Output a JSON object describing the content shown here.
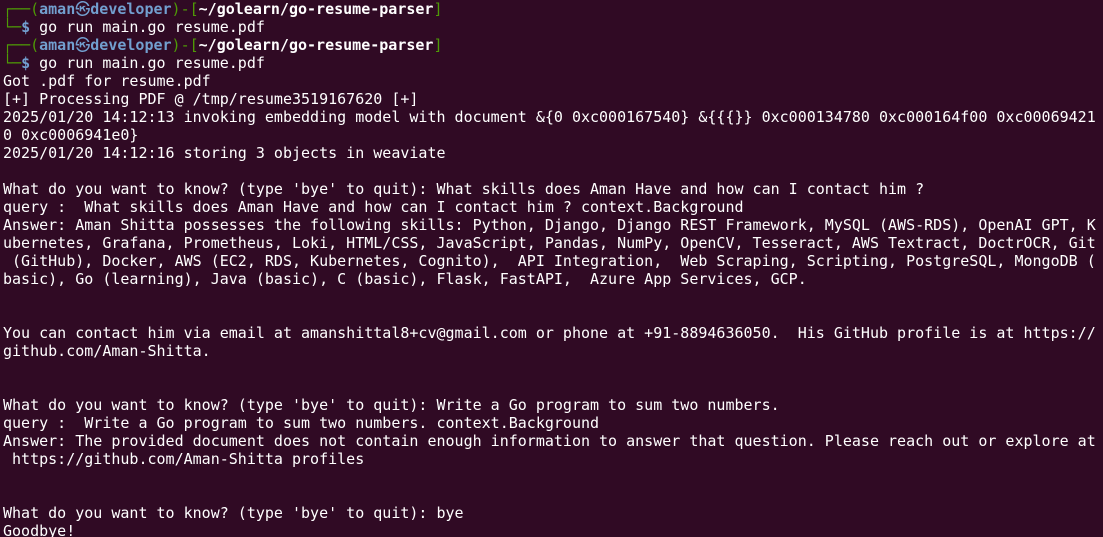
{
  "prompts": [
    {
      "frame_open": "┌──(",
      "user": "aman",
      "skull": "㉿",
      "host": "developer",
      "frame_mid": ")-[",
      "path": "~/golearn/go-resume-parser",
      "frame_close": "]",
      "frame_bottom": "└─",
      "dollar": "$",
      "command": " go run main.go resume.pdf"
    },
    {
      "frame_open": "┌──(",
      "user": "aman",
      "skull": "㉿",
      "host": "developer",
      "frame_mid": ")-[",
      "path": "~/golearn/go-resume-parser",
      "frame_close": "]",
      "frame_bottom": "└─",
      "dollar": "$",
      "command": " go run main.go resume.pdf"
    }
  ],
  "output": {
    "got_pdf": "Got .pdf for resume.pdf",
    "processing": "[+] Processing PDF @ /tmp/resume3519167620 [+]",
    "invoking_1": "2025/01/20 14:12:13 invoking embedding model with document &{0 0xc000167540} &{{{}} 0xc000134780 0xc000164f00 0xc00069421",
    "invoking_2": "0 0xc0006941e0}",
    "storing": "2025/01/20 14:12:16 storing 3 objects in weaviate",
    "q1": "What do you want to know? (type 'bye' to quit): What skills does Aman Have and how can I contact him ?",
    "query1": "query :  What skills does Aman Have and how can I contact him ? context.Background",
    "answer1_1": "Answer: Aman Shitta possesses the following skills: Python, Django, Django REST Framework, MySQL (AWS-RDS), OpenAI GPT, K",
    "answer1_2": "ubernetes, Grafana, Prometheus, Loki, HTML/CSS, JavaScript, Pandas, NumPy, OpenCV, Tesseract, AWS Textract, DoctrOCR, Git",
    "answer1_3": " (GitHub), Docker, AWS (EC2, RDS, Kubernetes, Cognito),  API Integration,  Web Scraping, Scripting, PostgreSQL, MongoDB (",
    "answer1_4": "basic), Go (learning), Java (basic), C (basic), Flask, FastAPI,  Azure App Services, GCP.",
    "contact_1": "You can contact him via email at amanshittal8+cv@gmail.com or phone at +91-8894636050.  His GitHub profile is at https://",
    "contact_2": "github.com/Aman-Shitta.",
    "q2": "What do you want to know? (type 'bye' to quit): Write a Go program to sum two numbers.",
    "query2": "query :  Write a Go program to sum two numbers. context.Background",
    "answer2_1": "Answer: The provided document does not contain enough information to answer that question. Please reach out or explore at",
    "answer2_2": " https://github.com/Aman-Shitta profiles",
    "q3": "What do you want to know? (type 'bye' to quit): bye",
    "goodbye": "Goodbye!"
  },
  "colors": {
    "background": "#300a24",
    "frame_green": "#4e9a06",
    "prompt_blue": "#729fcf",
    "text": "#ffffff"
  }
}
